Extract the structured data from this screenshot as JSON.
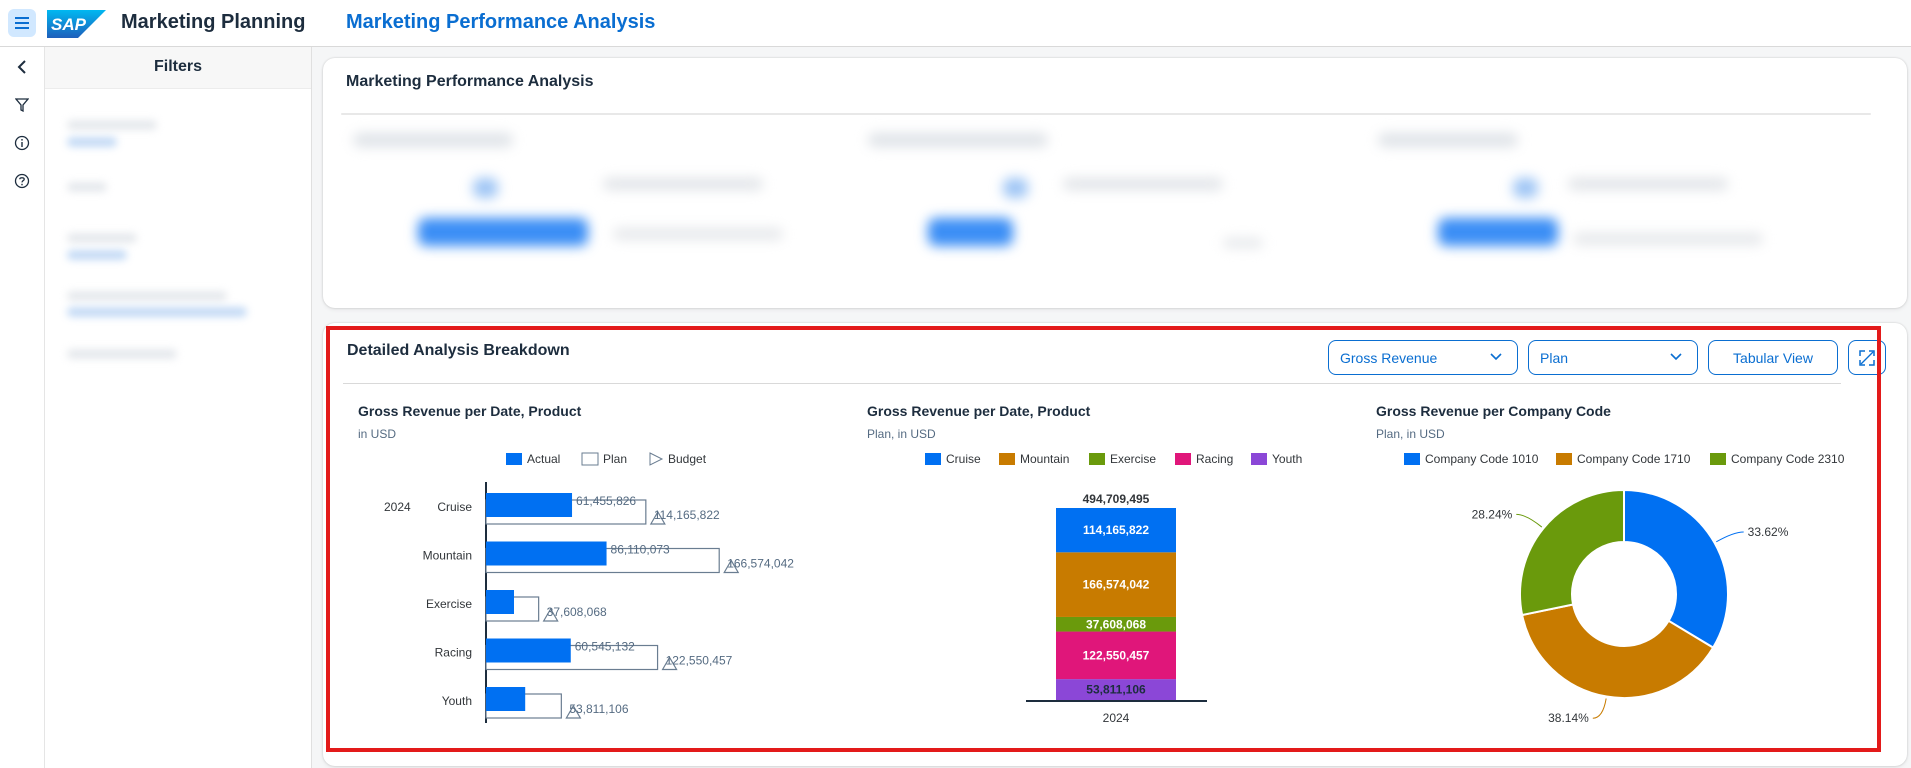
{
  "shell": {
    "app_title": "Marketing Planning",
    "page_title": "Marketing Performance Analysis",
    "logo_text": "SAP"
  },
  "filters": {
    "title": "Filters"
  },
  "overview": {
    "title": "Marketing Performance Analysis"
  },
  "breakdown": {
    "title": "Detailed Analysis Breakdown",
    "measure_select": "Gross Revenue",
    "version_select": "Plan",
    "tabular_view_label": "Tabular View"
  },
  "colors": {
    "brand_blue": "#0a6ed1",
    "actual": "#0070f2",
    "cruise": "#0070f2",
    "mountain": "#c87b00",
    "exercise": "#6a9a0c",
    "racing": "#e0167a",
    "youth": "#8b47d7"
  },
  "chart_data": [
    {
      "type": "bar",
      "title": "Gross Revenue per Date, Product",
      "subtitle": "in USD",
      "legend": [
        "Actual",
        "Plan",
        "Budget"
      ],
      "year": "2024",
      "categories": [
        "Cruise",
        "Mountain",
        "Exercise",
        "Racing",
        "Youth"
      ],
      "series": [
        {
          "name": "Actual",
          "values": [
            61455826,
            86110073,
            20000000,
            60545132,
            28000000
          ],
          "labels": [
            "61,455,826",
            "86,110,073",
            "",
            "60,545,132",
            ""
          ]
        },
        {
          "name": "Plan",
          "values": [
            114165822,
            166574042,
            37608068,
            122550457,
            53811106
          ],
          "labels": [
            "114,165,822",
            "166,574,042",
            "37,608,068",
            "122,550,457",
            "53,811,106"
          ]
        },
        {
          "name": "Budget",
          "values": [
            114165822,
            166574042,
            37608068,
            122550457,
            53811106
          ]
        }
      ],
      "xlim": [
        0,
        200000000
      ]
    },
    {
      "type": "bar",
      "stacked": true,
      "title": "Gross Revenue per Date, Product",
      "subtitle": "Plan, in USD",
      "categories": [
        "2024"
      ],
      "total_label": "494,709,495",
      "series": [
        {
          "name": "Cruise",
          "values": [
            114165822
          ],
          "label": "114,165,822"
        },
        {
          "name": "Mountain",
          "values": [
            166574042
          ],
          "label": "166,574,042"
        },
        {
          "name": "Exercise",
          "values": [
            37608068
          ],
          "label": "37,608,068"
        },
        {
          "name": "Racing",
          "values": [
            122550457
          ],
          "label": "122,550,457"
        },
        {
          "name": "Youth",
          "values": [
            53811106
          ],
          "label": "53,811,106"
        }
      ]
    },
    {
      "type": "pie",
      "donut": true,
      "title": "Gross Revenue per Company Code",
      "subtitle": "Plan, in USD",
      "slices": [
        {
          "name": "Company Code 1010",
          "value": 33.62,
          "label": "33.62%",
          "color": "#0070f2"
        },
        {
          "name": "Company Code 1710",
          "value": 38.14,
          "label": "38.14%",
          "color": "#c87b00"
        },
        {
          "name": "Company Code 2310",
          "value": 28.24,
          "label": "28.24%",
          "color": "#6a9a0c"
        }
      ]
    }
  ]
}
